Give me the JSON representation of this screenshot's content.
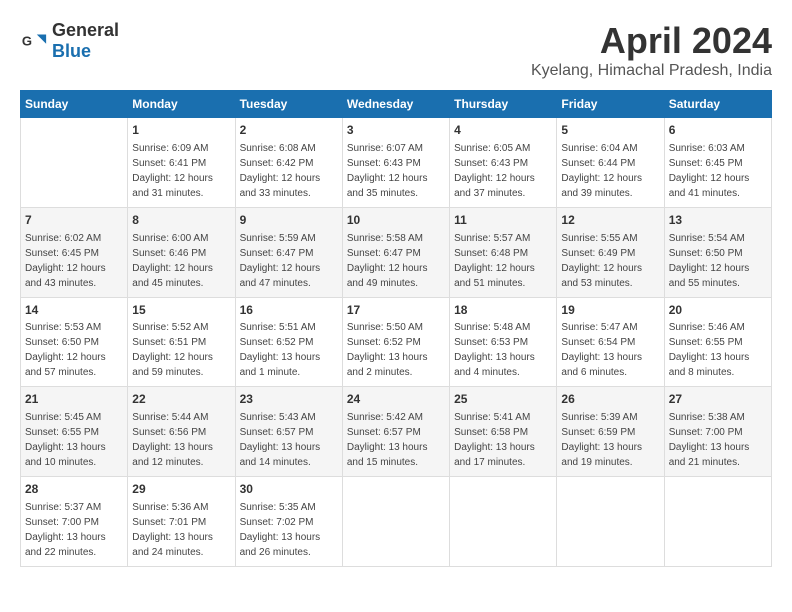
{
  "header": {
    "logo_general": "General",
    "logo_blue": "Blue",
    "title": "April 2024",
    "subtitle": "Kyelang, Himachal Pradesh, India"
  },
  "calendar": {
    "days_of_week": [
      "Sunday",
      "Monday",
      "Tuesday",
      "Wednesday",
      "Thursday",
      "Friday",
      "Saturday"
    ],
    "weeks": [
      [
        {
          "day": "",
          "info": ""
        },
        {
          "day": "1",
          "info": "Sunrise: 6:09 AM\nSunset: 6:41 PM\nDaylight: 12 hours\nand 31 minutes."
        },
        {
          "day": "2",
          "info": "Sunrise: 6:08 AM\nSunset: 6:42 PM\nDaylight: 12 hours\nand 33 minutes."
        },
        {
          "day": "3",
          "info": "Sunrise: 6:07 AM\nSunset: 6:43 PM\nDaylight: 12 hours\nand 35 minutes."
        },
        {
          "day": "4",
          "info": "Sunrise: 6:05 AM\nSunset: 6:43 PM\nDaylight: 12 hours\nand 37 minutes."
        },
        {
          "day": "5",
          "info": "Sunrise: 6:04 AM\nSunset: 6:44 PM\nDaylight: 12 hours\nand 39 minutes."
        },
        {
          "day": "6",
          "info": "Sunrise: 6:03 AM\nSunset: 6:45 PM\nDaylight: 12 hours\nand 41 minutes."
        }
      ],
      [
        {
          "day": "7",
          "info": "Sunrise: 6:02 AM\nSunset: 6:45 PM\nDaylight: 12 hours\nand 43 minutes."
        },
        {
          "day": "8",
          "info": "Sunrise: 6:00 AM\nSunset: 6:46 PM\nDaylight: 12 hours\nand 45 minutes."
        },
        {
          "day": "9",
          "info": "Sunrise: 5:59 AM\nSunset: 6:47 PM\nDaylight: 12 hours\nand 47 minutes."
        },
        {
          "day": "10",
          "info": "Sunrise: 5:58 AM\nSunset: 6:47 PM\nDaylight: 12 hours\nand 49 minutes."
        },
        {
          "day": "11",
          "info": "Sunrise: 5:57 AM\nSunset: 6:48 PM\nDaylight: 12 hours\nand 51 minutes."
        },
        {
          "day": "12",
          "info": "Sunrise: 5:55 AM\nSunset: 6:49 PM\nDaylight: 12 hours\nand 53 minutes."
        },
        {
          "day": "13",
          "info": "Sunrise: 5:54 AM\nSunset: 6:50 PM\nDaylight: 12 hours\nand 55 minutes."
        }
      ],
      [
        {
          "day": "14",
          "info": "Sunrise: 5:53 AM\nSunset: 6:50 PM\nDaylight: 12 hours\nand 57 minutes."
        },
        {
          "day": "15",
          "info": "Sunrise: 5:52 AM\nSunset: 6:51 PM\nDaylight: 12 hours\nand 59 minutes."
        },
        {
          "day": "16",
          "info": "Sunrise: 5:51 AM\nSunset: 6:52 PM\nDaylight: 13 hours\nand 1 minute."
        },
        {
          "day": "17",
          "info": "Sunrise: 5:50 AM\nSunset: 6:52 PM\nDaylight: 13 hours\nand 2 minutes."
        },
        {
          "day": "18",
          "info": "Sunrise: 5:48 AM\nSunset: 6:53 PM\nDaylight: 13 hours\nand 4 minutes."
        },
        {
          "day": "19",
          "info": "Sunrise: 5:47 AM\nSunset: 6:54 PM\nDaylight: 13 hours\nand 6 minutes."
        },
        {
          "day": "20",
          "info": "Sunrise: 5:46 AM\nSunset: 6:55 PM\nDaylight: 13 hours\nand 8 minutes."
        }
      ],
      [
        {
          "day": "21",
          "info": "Sunrise: 5:45 AM\nSunset: 6:55 PM\nDaylight: 13 hours\nand 10 minutes."
        },
        {
          "day": "22",
          "info": "Sunrise: 5:44 AM\nSunset: 6:56 PM\nDaylight: 13 hours\nand 12 minutes."
        },
        {
          "day": "23",
          "info": "Sunrise: 5:43 AM\nSunset: 6:57 PM\nDaylight: 13 hours\nand 14 minutes."
        },
        {
          "day": "24",
          "info": "Sunrise: 5:42 AM\nSunset: 6:57 PM\nDaylight: 13 hours\nand 15 minutes."
        },
        {
          "day": "25",
          "info": "Sunrise: 5:41 AM\nSunset: 6:58 PM\nDaylight: 13 hours\nand 17 minutes."
        },
        {
          "day": "26",
          "info": "Sunrise: 5:39 AM\nSunset: 6:59 PM\nDaylight: 13 hours\nand 19 minutes."
        },
        {
          "day": "27",
          "info": "Sunrise: 5:38 AM\nSunset: 7:00 PM\nDaylight: 13 hours\nand 21 minutes."
        }
      ],
      [
        {
          "day": "28",
          "info": "Sunrise: 5:37 AM\nSunset: 7:00 PM\nDaylight: 13 hours\nand 22 minutes."
        },
        {
          "day": "29",
          "info": "Sunrise: 5:36 AM\nSunset: 7:01 PM\nDaylight: 13 hours\nand 24 minutes."
        },
        {
          "day": "30",
          "info": "Sunrise: 5:35 AM\nSunset: 7:02 PM\nDaylight: 13 hours\nand 26 minutes."
        },
        {
          "day": "",
          "info": ""
        },
        {
          "day": "",
          "info": ""
        },
        {
          "day": "",
          "info": ""
        },
        {
          "day": "",
          "info": ""
        }
      ]
    ]
  }
}
